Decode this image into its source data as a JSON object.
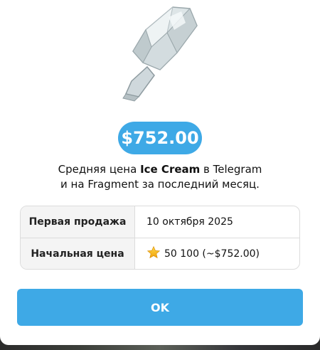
{
  "gift": {
    "name": "Ice Cream"
  },
  "price_badge": "$752.00",
  "description": {
    "line1_prefix": "Средняя цена ",
    "line1_name": "Ice Cream",
    "line1_suffix": " в Telegram",
    "line2": "и на Fragment за последний месяц."
  },
  "info_table": {
    "rows": [
      {
        "label": "Первая продажа",
        "value": "10 октября 2025",
        "icon": null
      },
      {
        "label": "Начальная цена",
        "value": "50 100 (~$752.00)",
        "icon": "star-icon"
      }
    ]
  },
  "ok_button": "OK",
  "colors": {
    "accent": "#3ea9e6",
    "table_border": "#dcdcdc",
    "label_bg": "#f4f4f4"
  }
}
